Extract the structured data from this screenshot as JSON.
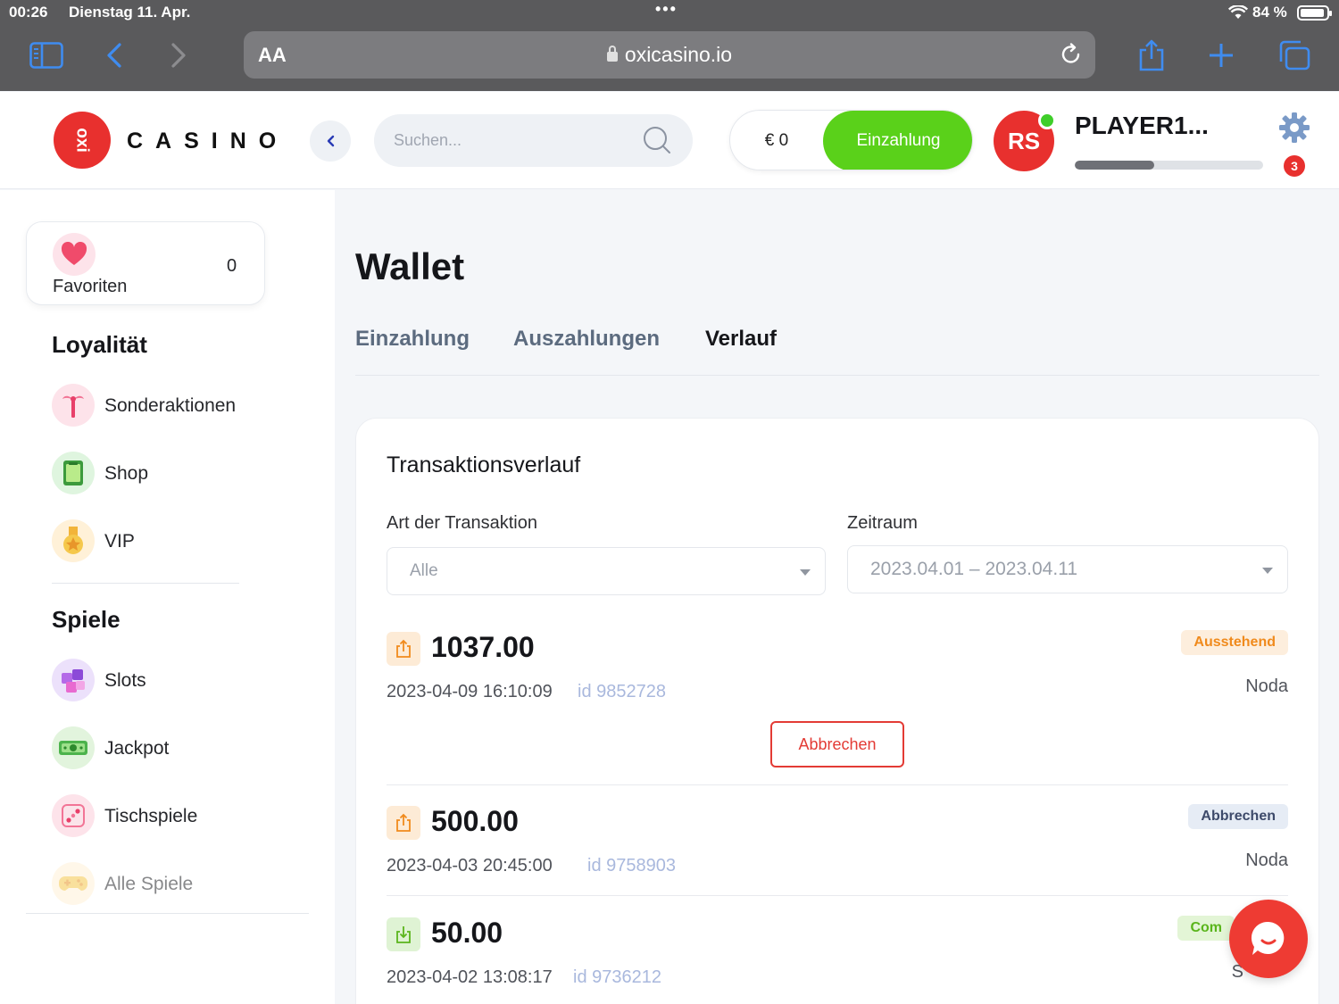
{
  "status_bar": {
    "time": "00:26",
    "date": "Dienstag 11. Apr.",
    "battery": "84 %"
  },
  "browser": {
    "text_size_label": "AA",
    "url": "oxicasino.io"
  },
  "header": {
    "logo_mark": "oxi",
    "logo_text": "CASINO",
    "search_placeholder": "Suchen...",
    "balance": "€ 0",
    "deposit_label": "Einzahlung",
    "avatar_initials": "RS",
    "player_name": "PLAYER1...",
    "xp_progress": 0.42,
    "notification_count": "3"
  },
  "sidebar": {
    "favorites": {
      "label": "Favoriten",
      "count": "0"
    },
    "loyalty_title": "Loyalität",
    "loyalty_items": [
      {
        "label": "Sonderaktionen",
        "icon": "palm-tree-icon"
      },
      {
        "label": "Shop",
        "icon": "shop-icon"
      },
      {
        "label": "VIP",
        "icon": "vip-medal-icon"
      }
    ],
    "games_title": "Spiele",
    "games_items": [
      {
        "label": "Slots",
        "icon": "slots-icon"
      },
      {
        "label": "Jackpot",
        "icon": "jackpot-icon"
      },
      {
        "label": "Tischspiele",
        "icon": "dice-icon"
      },
      {
        "label": "Alle Spiele",
        "icon": "gamepad-icon"
      }
    ]
  },
  "main": {
    "title": "Wallet",
    "tabs": [
      {
        "label": "Einzahlung",
        "active": false
      },
      {
        "label": "Auszahlungen",
        "active": false
      },
      {
        "label": "Verlauf",
        "active": true
      }
    ],
    "card_title": "Transaktionsverlauf",
    "filter_type_label": "Art der Transaktion",
    "filter_type_value": "Alle",
    "filter_period_label": "Zeitraum",
    "filter_period_value": "2023.04.01 – 2023.04.11",
    "transactions": [
      {
        "direction": "out",
        "amount": "1037.00",
        "datetime": "2023-04-09 16:10:09",
        "id": "id 9852728",
        "status": "Ausstehend",
        "method": "Noda",
        "action": "Abbrechen"
      },
      {
        "direction": "out",
        "amount": "500.00",
        "datetime": "2023-04-03 20:45:00",
        "id": "id 9758903",
        "status": "Abbrechen",
        "method": "Noda"
      },
      {
        "direction": "in",
        "amount": "50.00",
        "datetime": "2023-04-02 13:08:17",
        "id": "id 9736212",
        "status": "Com",
        "method": "S"
      }
    ]
  },
  "colors": {
    "brand_red": "#e8302e",
    "deposit_green": "#5ad11a",
    "pending_orange": "#f08a1c",
    "cancel_blue": "#3d4a6a",
    "complete_green": "#5ab51c"
  }
}
